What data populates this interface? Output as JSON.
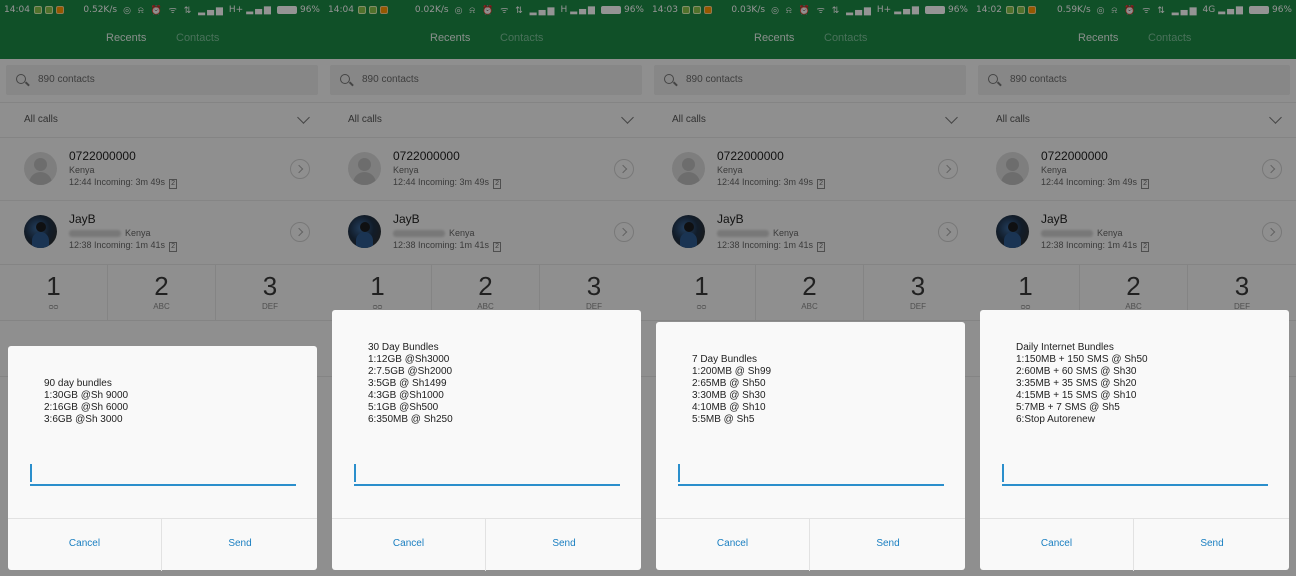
{
  "colors": {
    "status_bar": "#1d8a46",
    "accent": "#2b8fcc",
    "button_text": "#1a7fc1"
  },
  "tabs": {
    "recents": "Recents",
    "contacts": "Contacts"
  },
  "search": {
    "placeholder": "890 contacts"
  },
  "filter": {
    "label": "All calls"
  },
  "calls": [
    {
      "name": "0722000000",
      "location": "Kenya",
      "time_line": "12:44 Incoming: 3m 49s",
      "sim": "2"
    },
    {
      "name": "JayB",
      "location": "Kenya",
      "time_line": "12:38 Incoming: 1m 41s",
      "sim": "2"
    }
  ],
  "dialpad": [
    {
      "digit": "1",
      "letters": "ᴑᴑ"
    },
    {
      "digit": "2",
      "letters": "ABC"
    },
    {
      "digit": "3",
      "letters": "DEF"
    }
  ],
  "buttons": {
    "cancel": "Cancel",
    "send": "Send"
  },
  "screens": [
    {
      "status": {
        "time": "14:04",
        "speed": "0.52K/s",
        "network": "H+",
        "battery": "96%"
      },
      "dialog": {
        "lines": [
          "90 day bundles",
          "1:30GB @Sh 9000",
          "2:16GB @Sh 6000",
          "3:6GB @Sh 3000"
        ]
      }
    },
    {
      "status": {
        "time": "14:04",
        "speed": "0.02K/s",
        "network": "H",
        "battery": "96%"
      },
      "dialog": {
        "lines": [
          "30 Day Bundles",
          "1:12GB @Sh3000",
          "2:7.5GB @Sh2000",
          "3:5GB @ Sh1499",
          "4:3GB @Sh1000",
          "5:1GB @Sh500",
          "6:350MB @ Sh250"
        ]
      }
    },
    {
      "status": {
        "time": "14:03",
        "speed": "0.03K/s",
        "network": "H+",
        "battery": "96%"
      },
      "dialog": {
        "lines": [
          "7 Day Bundles",
          "1:200MB @ Sh99",
          "2:65MB @ Sh50",
          "3:30MB @ Sh30",
          "4:10MB @ Sh10",
          "5:5MB @ Sh5"
        ]
      }
    },
    {
      "status": {
        "time": "14:02",
        "speed": "0.59K/s",
        "network": "4G",
        "battery": "96%"
      },
      "dialog": {
        "lines": [
          "Daily Internet Bundles",
          "1:150MB + 150 SMS @ Sh50",
          "2:60MB + 60 SMS @ Sh30",
          "3:35MB + 35 SMS @ Sh20",
          "4:15MB + 15 SMS @ Sh10",
          "5:7MB + 7 SMS @ Sh5",
          "6:Stop Autorenew"
        ]
      }
    }
  ]
}
